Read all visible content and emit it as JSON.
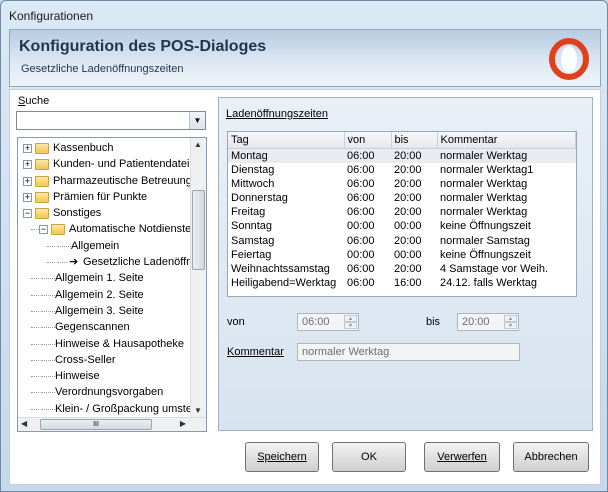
{
  "window": {
    "title": "Konfigurationen"
  },
  "header": {
    "title": "Konfiguration des POS-Dialoges",
    "subtitle": "Gesetzliche Ladenöffnungszeiten",
    "logo_icon": "o-ring-logo",
    "logo_color": "#e0401c"
  },
  "search": {
    "label": "Suche",
    "value": ""
  },
  "tree": {
    "rows": [
      {
        "label": "Kassenbuch",
        "level": 0,
        "expander": "+",
        "folder": true
      },
      {
        "label": "Kunden- und Patientendatei",
        "level": 0,
        "expander": "+",
        "folder": true
      },
      {
        "label": "Pharmazeutische Betreuung",
        "level": 0,
        "expander": "+",
        "folder": true
      },
      {
        "label": "Prämien für Punkte",
        "level": 0,
        "expander": "+",
        "folder": true
      },
      {
        "label": "Sonstiges",
        "level": 0,
        "expander": "−",
        "folder": true
      },
      {
        "label": "Automatische Notdienste",
        "level": 1,
        "expander": "−",
        "folder": true
      },
      {
        "label": "Allgemein",
        "level": 2,
        "expander": "",
        "folder": false
      },
      {
        "label": "Gesetzliche Ladenöffnungszeiten",
        "level": 2,
        "expander": "",
        "folder": false,
        "arrow": true
      },
      {
        "label": "Allgemein 1. Seite",
        "level": 1,
        "expander": "",
        "folder": false
      },
      {
        "label": "Allgemein 2. Seite",
        "level": 1,
        "expander": "",
        "folder": false
      },
      {
        "label": "Allgemein 3. Seite",
        "level": 1,
        "expander": "",
        "folder": false
      },
      {
        "label": "Gegenscannen",
        "level": 1,
        "expander": "",
        "folder": false
      },
      {
        "label": "Hinweise & Hausapotheke",
        "level": 1,
        "expander": "",
        "folder": false
      },
      {
        "label": "Cross-Seller",
        "level": 1,
        "expander": "",
        "folder": false
      },
      {
        "label": "Hinweise",
        "level": 1,
        "expander": "",
        "folder": false
      },
      {
        "label": "Verordnungsvorgaben",
        "level": 1,
        "expander": "",
        "folder": false
      },
      {
        "label": "Klein- / Großpackung umstellen",
        "level": 1,
        "expander": "",
        "folder": false
      }
    ]
  },
  "panel": {
    "title": "Ladenöffnungszeiten",
    "columns": [
      "Tag",
      "von",
      "bis",
      "Kommentar"
    ],
    "rows": [
      {
        "tag": "Montag",
        "von": "06:00",
        "bis": "20:00",
        "kommentar": "normaler Werktag"
      },
      {
        "tag": "Dienstag",
        "von": "06:00",
        "bis": "20:00",
        "kommentar": "normaler Werktag1"
      },
      {
        "tag": "Mittwoch",
        "von": "06:00",
        "bis": "20:00",
        "kommentar": "normaler Werktag"
      },
      {
        "tag": "Donnerstag",
        "von": "06:00",
        "bis": "20:00",
        "kommentar": "normaler Werktag"
      },
      {
        "tag": "Freitag",
        "von": "06:00",
        "bis": "20:00",
        "kommentar": "normaler Werktag"
      },
      {
        "tag": "Sonntag",
        "von": "00:00",
        "bis": "00:00",
        "kommentar": "keine Öffnungszeit"
      },
      {
        "tag": "Samstag",
        "von": "06:00",
        "bis": "20:00",
        "kommentar": "normaler Samstag"
      },
      {
        "tag": "Feiertag",
        "von": "00:00",
        "bis": "00:00",
        "kommentar": "keine Öffnungszeit"
      },
      {
        "tag": "Weihnachtssamstag",
        "von": "06:00",
        "bis": "20:00",
        "kommentar": "4 Samstage vor Weih."
      },
      {
        "tag": "Heiligabend=Werktag",
        "von": "06:00",
        "bis": "16:00",
        "kommentar": "24.12. falls Werktag"
      }
    ]
  },
  "form": {
    "von_label": "von",
    "von_value": "06:00",
    "bis_label": "bis",
    "bis_value": "20:00",
    "kommentar_label": "Kommentar",
    "kommentar_value": "normaler Werktag"
  },
  "buttons": {
    "save": "Speichern",
    "ok": "OK",
    "discard": "Verwerfen",
    "cancel": "Abbrechen"
  }
}
